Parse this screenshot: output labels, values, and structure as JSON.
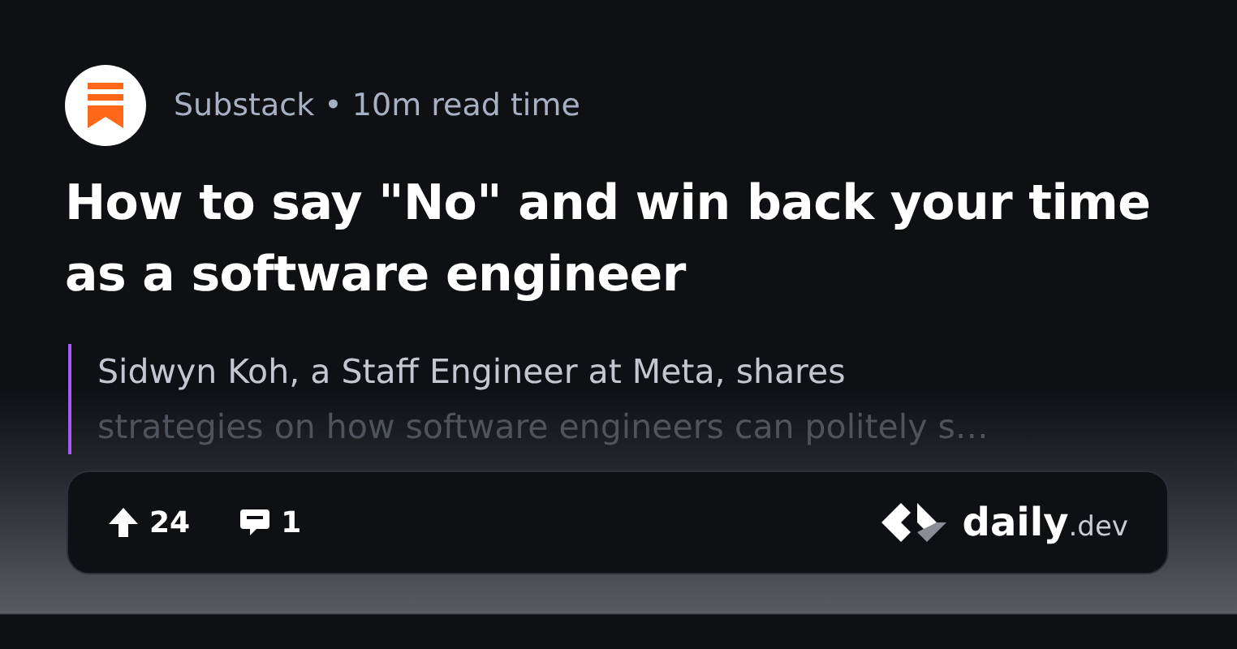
{
  "source": {
    "name": "Substack",
    "separator": "•",
    "read_time": "10m read time"
  },
  "title": "How to say \"No\" and win back your time as a software engineer",
  "summary": [
    "Sidwyn Koh, a Staff Engineer at Meta, shares",
    "strategies on how software engineers can politely s…"
  ],
  "footer": {
    "upvotes": "24",
    "comments": "1",
    "brand": "daily",
    "brand_suffix": ".dev"
  }
}
